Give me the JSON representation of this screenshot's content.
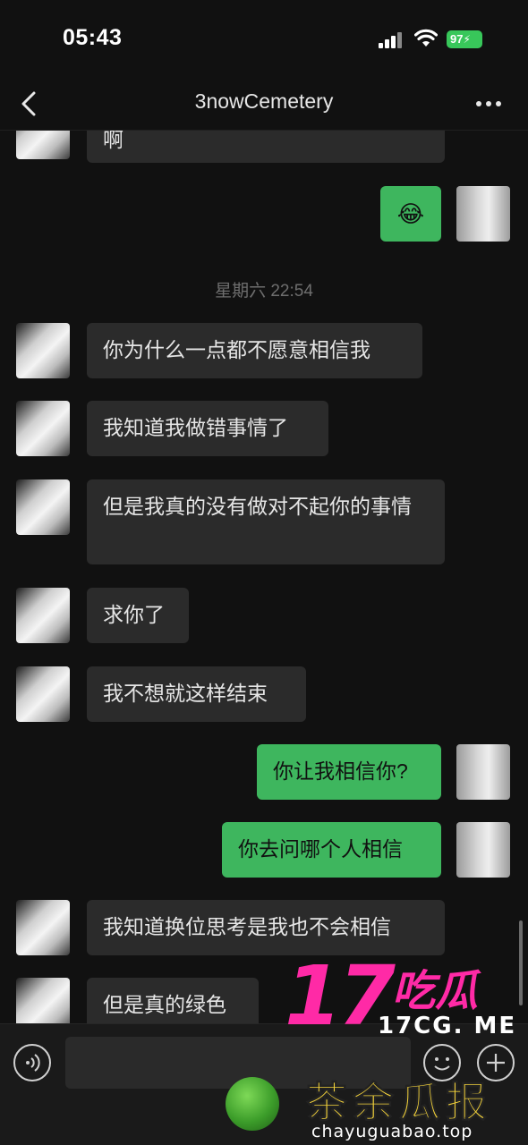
{
  "status_bar": {
    "time": "05:43",
    "battery": "97"
  },
  "nav": {
    "title": "3nowCemetery"
  },
  "messages": [
    {
      "side": "left",
      "text": "啊",
      "partial": true
    },
    {
      "side": "right",
      "text": "😂"
    },
    {
      "type": "time",
      "text": "星期六 22:54"
    },
    {
      "side": "left",
      "text": "你为什么一点都不愿意相信我"
    },
    {
      "side": "left",
      "text": "我知道我做错事情了"
    },
    {
      "side": "left",
      "text": "但是我真的没有做对不起你的事情"
    },
    {
      "side": "left",
      "text": "求你了"
    },
    {
      "side": "left",
      "text": "我不想就这样结束"
    },
    {
      "side": "right",
      "text": "你让我相信你?"
    },
    {
      "side": "right",
      "text": "你去问哪个人相信"
    },
    {
      "side": "left",
      "text": "我知道换位思考是我也不会相信"
    },
    {
      "side": "left",
      "text": "但是真的绿色",
      "partial": true
    }
  ],
  "input": {
    "placeholder": ""
  },
  "watermark": {
    "logo_number": "17",
    "logo_text": "吃瓜",
    "site1": "17CG. ME",
    "brand": "茶余瓜报",
    "site2": "chayuguabao.top"
  },
  "colors": {
    "bubble_self": "#3eb65e",
    "bubble_other": "#2b2b2b",
    "background": "#111111",
    "watermark_pink": "#ff2aa6",
    "watermark_yellow": "#f3d23a"
  },
  "icons": [
    "back-chevron-icon",
    "more-dots-icon",
    "signal-icon",
    "wifi-icon",
    "battery-icon",
    "voice-icon",
    "emoji-icon",
    "plus-icon"
  ]
}
